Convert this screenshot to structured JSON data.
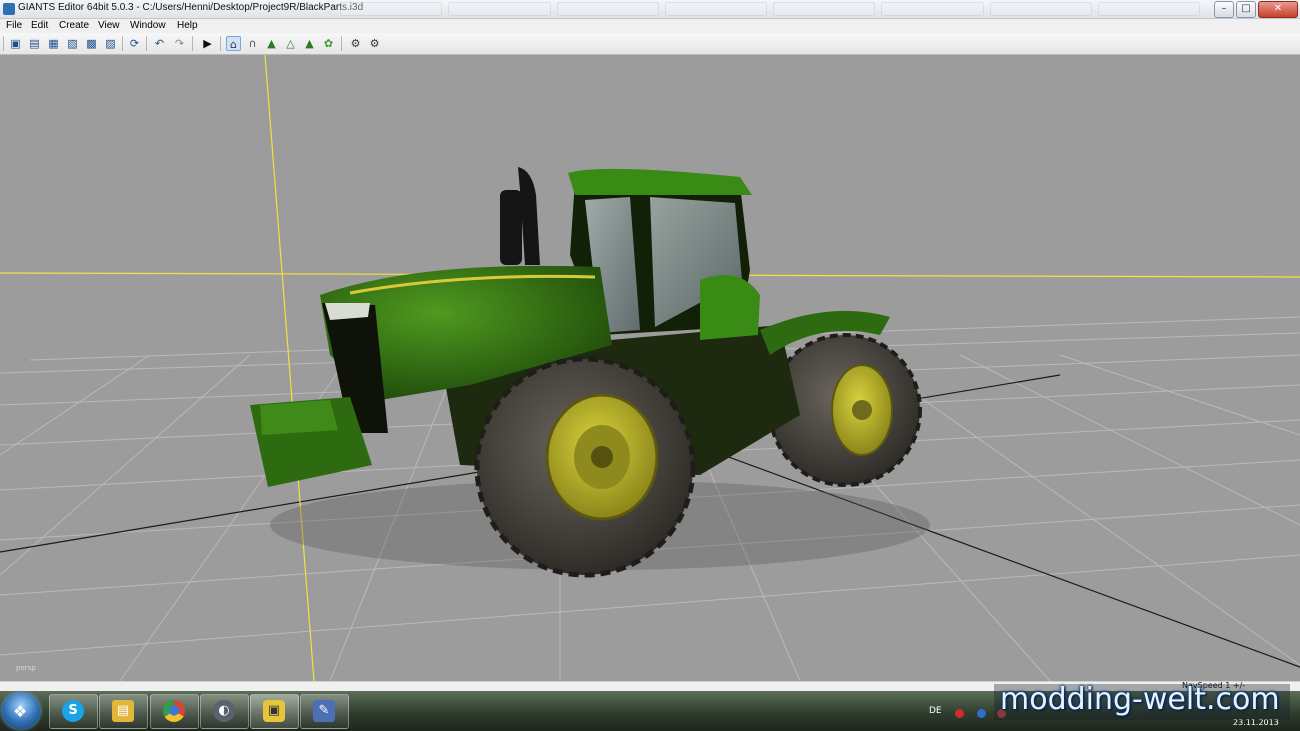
{
  "window": {
    "title": "GIANTS Editor 64bit 5.0.3 - C:/Users/Henni/Desktop/Project9R/BlackParts.i3d",
    "minimize": "–",
    "maximize": "□",
    "close": "✕"
  },
  "menu": [
    "File",
    "Edit",
    "Create",
    "View",
    "Window",
    "Help"
  ],
  "toolbar": {
    "icons": [
      "new-icon",
      "open-icon",
      "import-icon",
      "export-icon",
      "save-icon",
      "save-as-icon",
      "refresh-icon",
      "undo-icon",
      "redo-icon",
      "play-icon",
      "select-mode-icon",
      "move-mode-icon",
      "terrain-icon",
      "terrain-paint-icon",
      "foliage-icon",
      "foliage-paint-icon",
      "settings-icon",
      "render-settings-icon"
    ]
  },
  "viewport": {
    "camera_label": "persp",
    "background": "#9c9c9c",
    "axis_color": "#f2e33a"
  },
  "status": {
    "nav_speed": "NavSpeed 1 +/-"
  },
  "taskbar": {
    "start_icon": "windows-start-icon",
    "apps": [
      {
        "name": "skype-icon",
        "glyph": "S",
        "color": "#1aa3e8"
      },
      {
        "name": "file-explorer-icon",
        "glyph": "▤",
        "color": "#e2b53b"
      },
      {
        "name": "chrome-icon",
        "glyph": "●",
        "color": "#d64535"
      },
      {
        "name": "media-player-icon",
        "glyph": "◐",
        "color": "#5a6270"
      },
      {
        "name": "giants-editor-icon",
        "glyph": "▣",
        "color": "#e4c63a"
      },
      {
        "name": "paint-icon",
        "glyph": "✎",
        "color": "#4c6fb5"
      }
    ],
    "language": "DE",
    "date": "23.11.2013"
  },
  "watermark": "modding-welt.com"
}
